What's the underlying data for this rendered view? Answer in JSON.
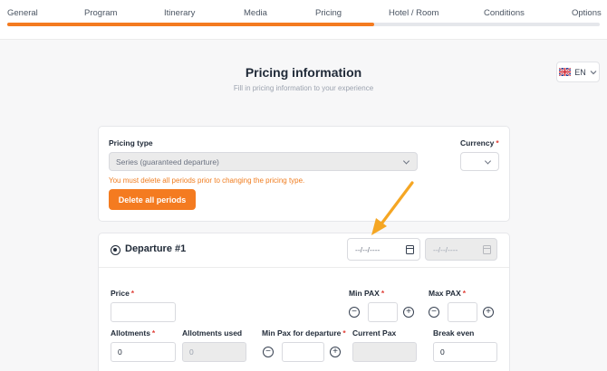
{
  "steps": {
    "items": [
      "General",
      "Program",
      "Itinerary",
      "Media",
      "Pricing",
      "Hotel / Room",
      "Conditions",
      "Options"
    ],
    "progress": 0.62,
    "color": "#f47b20"
  },
  "header": {
    "title": "Pricing information",
    "subtitle": "Fill in pricing information to your experience"
  },
  "language": {
    "code": "EN",
    "icon": "uk-flag-icon"
  },
  "pricing": {
    "type_label": "Pricing type",
    "type_value": "Series (guaranteed departure)",
    "currency_label": "Currency",
    "currency_value": "",
    "warning": "You must delete all periods prior to changing the pricing type.",
    "delete_button": "Delete all periods"
  },
  "departure": {
    "title": "Departure #1",
    "start_date": "--/--/----",
    "end_date": "--/--/----",
    "price_label": "Price",
    "price_value": "",
    "min_pax_label": "Min PAX",
    "min_pax_value": "",
    "max_pax_label": "Max PAX",
    "max_pax_value": "",
    "allotments_label": "Allotments",
    "allotments_value": "0",
    "allotments_used_label": "Allotments used",
    "allotments_used_value": "0",
    "min_pax_departure_label": "Min Pax for departure",
    "min_pax_departure_value": "",
    "current_pax_label": "Current Pax",
    "current_pax_value": "",
    "break_even_label": "Break even",
    "break_even_value": "0"
  },
  "required_mark": "*",
  "icons": {
    "minus": "−",
    "plus": "+"
  }
}
